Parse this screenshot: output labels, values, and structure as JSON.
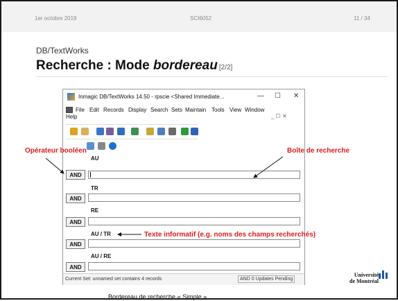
{
  "slide": {
    "date": "1er octobre 2019",
    "course": "SCI6052",
    "page": "11 / 34",
    "subtitle": "DB/TextWorks",
    "title_main": "Recherche : Mode ",
    "title_em": "bordereau",
    "title_part": "[2/2]",
    "caption": "Bordereau de recherche « Simple »",
    "logo_line1": "Université",
    "logo_line2": "de Montréal"
  },
  "annotations": {
    "bool_op": "Opérateur booléen",
    "search_box": "Boîte de recherche",
    "info_text": "Texte informatif (e.g. noms des champs recherchés)"
  },
  "window": {
    "title": "Inmagic DB/TextWorks 14.50  - rpscie <Shared Immediate...",
    "minimize": "—",
    "maximize": "☐",
    "close": "✕",
    "menu": [
      "File",
      "Edit",
      "Records",
      "Display",
      "Search",
      "Sets",
      "Maintain",
      "Tools",
      "View",
      "Window",
      "Help"
    ],
    "mini_controls": "_  ☐  ✕",
    "rows": [
      {
        "label": "AU",
        "operator": "AND"
      },
      {
        "label": "TR",
        "operator": "AND"
      },
      {
        "label": "RE",
        "operator": "AND"
      },
      {
        "label": "AU / TR",
        "operator": "AND"
      },
      {
        "label": "AU / RE",
        "operator": "AND"
      }
    ],
    "status_left": "Current Set: unnamed set contains 4 records",
    "status_right": "AND  0 Updates Pending"
  },
  "colors": {
    "annotation": "#e01b1b",
    "header_bg": "#f2f2f2"
  }
}
